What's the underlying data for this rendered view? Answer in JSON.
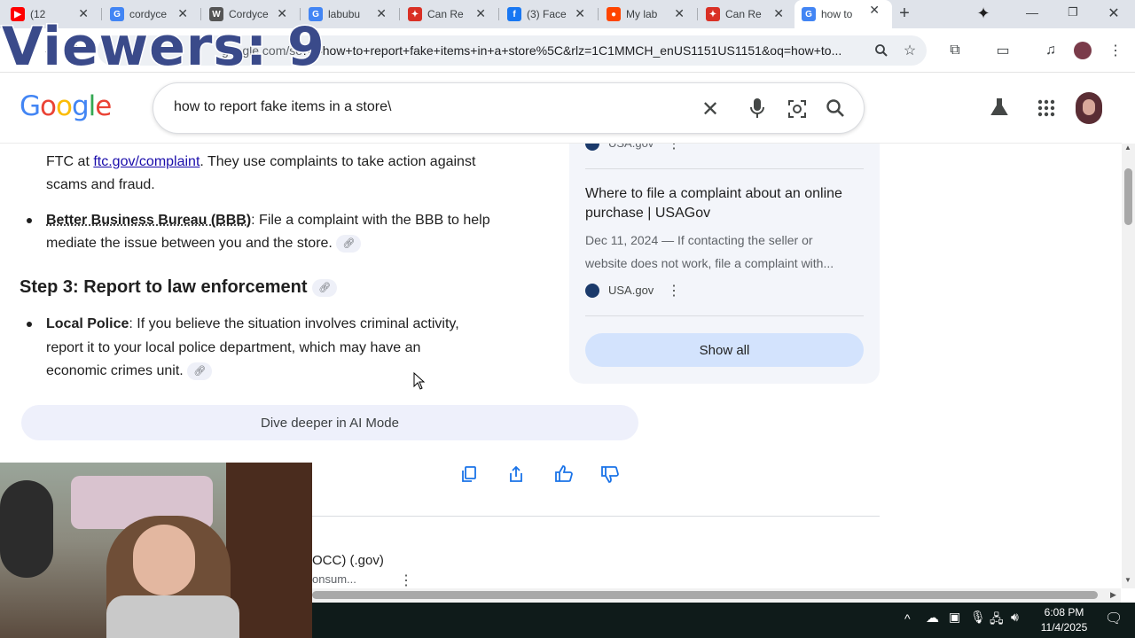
{
  "tabs": [
    {
      "title": "(12",
      "icon": "youtube-icon",
      "color": "#ff0000",
      "glyph": "▶"
    },
    {
      "title": "cordyce",
      "icon": "google-icon",
      "color": "#4285f4",
      "glyph": "G"
    },
    {
      "title": "Cordyce",
      "icon": "wikipedia-icon",
      "color": "#555555",
      "glyph": "W"
    },
    {
      "title": "labubu",
      "icon": "google-icon",
      "color": "#4285f4",
      "glyph": "G"
    },
    {
      "title": "Can Re",
      "icon": "app-icon",
      "color": "#d93025",
      "glyph": "✦"
    },
    {
      "title": "(3) Face",
      "icon": "facebook-icon",
      "color": "#1877f2",
      "glyph": "f"
    },
    {
      "title": "My lab",
      "icon": "reddit-icon",
      "color": "#ff4500",
      "glyph": "●"
    },
    {
      "title": "Can Re",
      "icon": "app-icon",
      "color": "#d93025",
      "glyph": "✦"
    },
    {
      "title": "how to",
      "icon": "google-icon",
      "color": "#4285f4",
      "glyph": "G"
    }
  ],
  "overlay": {
    "viewers": "Viewers: 9"
  },
  "omnibox": {
    "url": "?q=how+to+report+fake+items+in+a+store%5C&rlz=1C1MMCH_enUS1151US1151&oq=how+to...",
    "url_prefix": "google.com/se"
  },
  "search": {
    "logo": "Google",
    "query": "how to report fake items in a store\\"
  },
  "main": {
    "ftc_prefix": "FTC at ",
    "ftc_link": "ftc.gov/complaint",
    "ftc_rest": ". They use complaints to take action against",
    "ftc_line2": "scams and fraud.",
    "bbb_bold": "Better Business Bureau (BBB)",
    "bbb_rest": ": File a complaint with the BBB to help",
    "bbb_line2": "mediate the issue between you and the store.",
    "step3": "Step 3: Report to law enforcement",
    "police_bold": "Local Police",
    "police_rest": ": If you believe the situation involves criminal activity,",
    "police_line2": "report it to your local police department, which may have an",
    "police_line3": "economic crimes unit.",
    "dive_deeper": "Dive deeper in AI Mode",
    "partial_source": "OCC) (.gov)",
    "partial_snippet": "onsum..."
  },
  "side": {
    "top_source": "USA.gov",
    "card_title": "Where to file a complaint about an online purchase | USAGov",
    "card_date": "Dec 11, 2024",
    "card_snippet_1": " — If contacting the seller or",
    "card_snippet_2": "website does not work, file a complaint with...",
    "card_source": "USA.gov",
    "show_all": "Show all"
  },
  "taskbar": {
    "time": "6:08 PM",
    "date": "11/4/2025"
  }
}
